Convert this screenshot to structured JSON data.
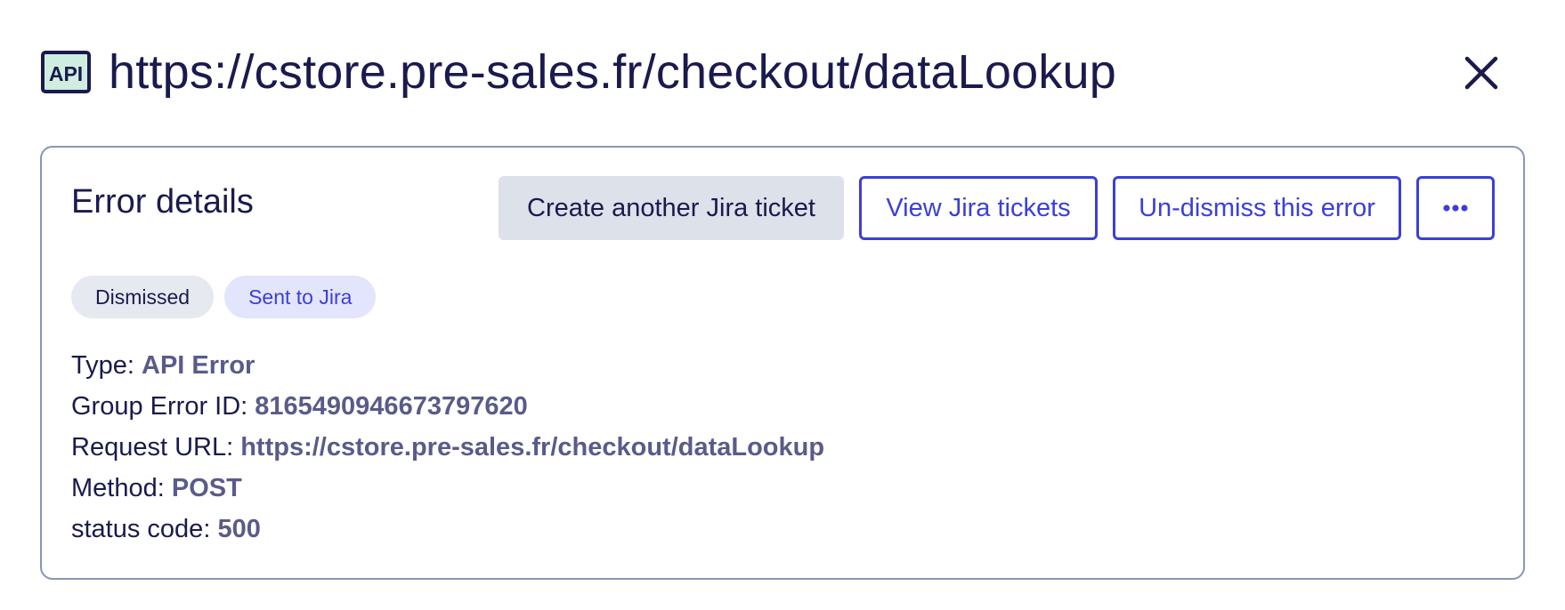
{
  "header": {
    "icon": "api-icon",
    "icon_text": "API",
    "title": "https://cstore.pre-sales.fr/checkout/dataLookup"
  },
  "card": {
    "title": "Error details",
    "actions": {
      "create_ticket": "Create another Jira ticket",
      "view_tickets": "View Jira tickets",
      "undismiss": "Un-dismiss this error",
      "more": "•••"
    },
    "badges": [
      {
        "label": "Dismissed",
        "color": "#e6e9ef"
      },
      {
        "label": "Sent to Jira",
        "color": "#e3e5fc"
      }
    ],
    "details": [
      {
        "label": "Type:",
        "value": "API Error"
      },
      {
        "label": "Group Error ID:",
        "value": "8165490946673797620"
      },
      {
        "label": "Request URL:",
        "value": "https://cstore.pre-sales.fr/checkout/dataLookup"
      },
      {
        "label": "Method:",
        "value": "POST"
      },
      {
        "label": "status code:",
        "value": "500"
      }
    ]
  },
  "colors": {
    "primary": "#1a1a4e",
    "accent": "#3b3fd8",
    "border": "#8796b8",
    "value_text": "#5a5b8a"
  }
}
